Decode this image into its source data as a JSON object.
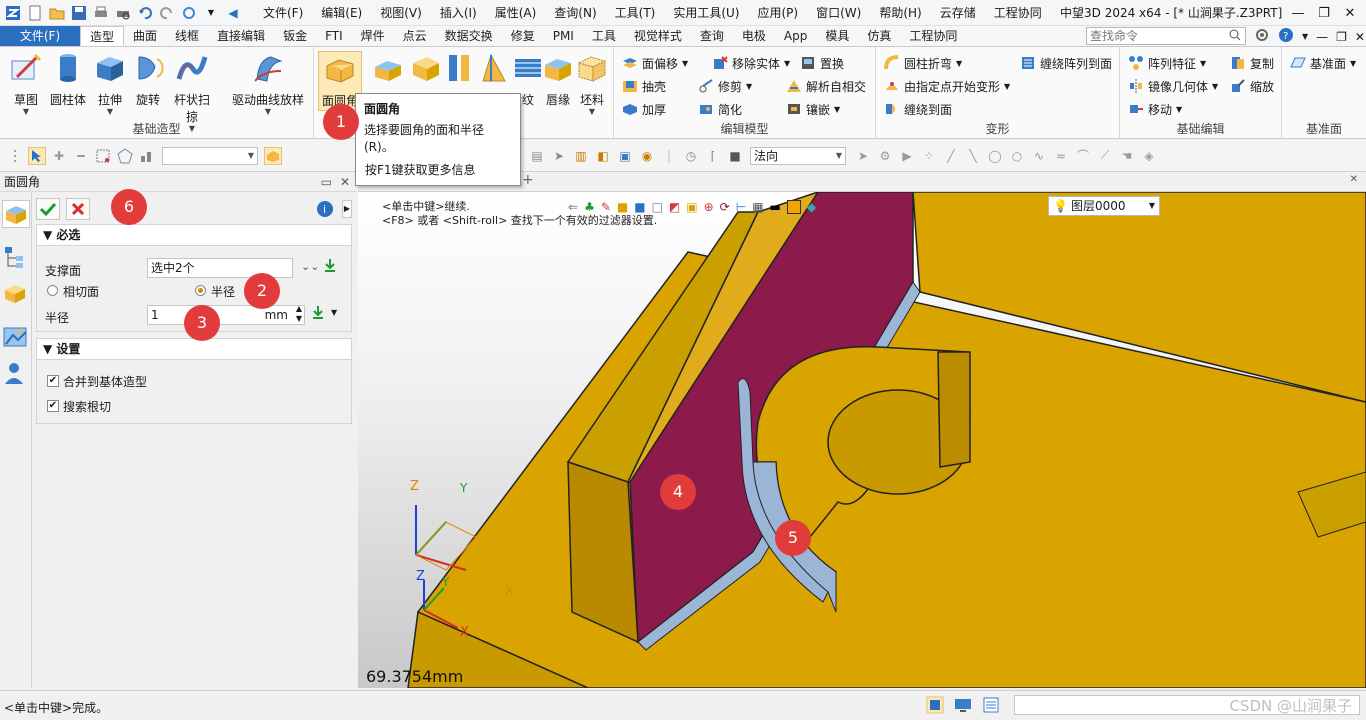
{
  "app": {
    "window_title": "中望3D 2024 x64 - [* 山涧果子.Z3PRT]"
  },
  "menu": [
    "文件(F)",
    "编辑(E)",
    "视图(V)",
    "插入(I)",
    "属性(A)",
    "查询(N)",
    "工具(T)",
    "实用工具(U)",
    "应用(P)",
    "窗口(W)",
    "帮助(H)",
    "云存储",
    "工程协同"
  ],
  "ribbon_tabs": {
    "file": "文件(F)",
    "items": [
      "造型",
      "曲面",
      "线框",
      "直接编辑",
      "钣金",
      "FTI",
      "焊件",
      "点云",
      "数据交换",
      "修复",
      "PMI",
      "工具",
      "视觉样式",
      "查询",
      "电极",
      "App",
      "模具",
      "仿真",
      "工程协同"
    ],
    "active": "造型",
    "search_placeholder": "查找命令"
  },
  "ribbon": {
    "basic_shapes": {
      "label": "基础造型",
      "buttons": [
        "草图",
        "圆柱体",
        "拉伸",
        "旋转",
        "杆状扫掠",
        "驱动曲线放样"
      ]
    },
    "engineering": {
      "first_button": "面圆角",
      "partial_labels": [
        "纹",
        "唇缘",
        "坯料"
      ]
    },
    "edit_model": {
      "label": "编辑模型",
      "items": [
        "面偏移",
        "移除实体",
        "置换",
        "抽壳",
        "修剪",
        "解析自相交",
        "加厚",
        "简化",
        "镶嵌"
      ]
    },
    "deform": {
      "label": "变形",
      "items": [
        "圆柱折弯",
        "由指定点开始变形",
        "缠绕到面",
        "缠绕阵列到面"
      ]
    },
    "basic_edit": {
      "label": "基础编辑",
      "items": [
        "阵列特征",
        "复制",
        "镜像几何体",
        "缩放",
        "移动"
      ]
    },
    "datum": {
      "label": "基准面",
      "button": "基准面"
    }
  },
  "tooltip": {
    "title": "面圆角",
    "desc": "选择要圆角的面和半径(R)。",
    "more": "按F1键获取更多信息"
  },
  "toolbar2": {
    "normal_combo": "法向"
  },
  "panel": {
    "title": "面圆角",
    "required_section": "必选",
    "support_face_label": "支撑面",
    "support_face_value": "选中2个",
    "tangent_face_label": "相切面",
    "radius_option_label": "半径",
    "radius_label": "半径",
    "radius_value": "1",
    "radius_unit": "mm",
    "settings_section": "设置",
    "merge_label": "合并到基体造型",
    "search_root_label": "搜索根切",
    "selected_option": "radius",
    "merge_checked": true,
    "search_root_checked": true
  },
  "viewport": {
    "prompt_line1": "<单击中键>继续.",
    "prompt_line2": "<F8> 或者 <Shift-roll> 查找下一个有效的过滤器设置.",
    "layer": "图层0000",
    "measurement": "69.3754mm",
    "axis_labels": [
      "Z",
      "Y",
      "X",
      "Z",
      "Y",
      "X"
    ]
  },
  "callouts": [
    "1",
    "2",
    "3",
    "4",
    "5",
    "6"
  ],
  "status": {
    "text": "<单击中键>完成。",
    "watermark": "CSDN @山涧果子"
  },
  "colors": {
    "accent_blue": "#2b6fc0",
    "model_yellow": "#d9a400",
    "face_selected": "#8c1a4a",
    "fillet_blue": "#9bb5d6",
    "callout_red": "#e23b3b"
  }
}
